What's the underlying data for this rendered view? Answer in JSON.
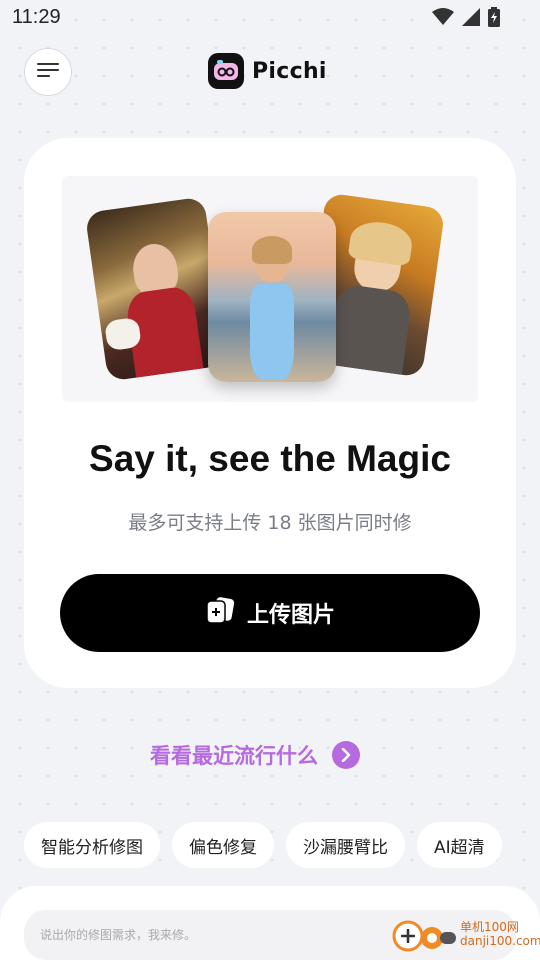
{
  "status_bar": {
    "time": "11:29",
    "icons": [
      "wifi-icon",
      "cell-signal-icon",
      "battery-icon"
    ]
  },
  "header": {
    "menu_icon": "hamburger-icon",
    "logo_text": "Picchi"
  },
  "hero": {
    "headline": "Say it, see the Magic",
    "subtitle": "最多可支持上传 18 张图片同时修",
    "upload_button_label": "上传图片",
    "upload_icon": "add-photo-icon",
    "photos": [
      "birthday-portrait-photo",
      "beach-portrait-photo",
      "autumn-portrait-photo"
    ]
  },
  "trending": {
    "label": "看看最近流行什么",
    "icon": "chevron-right-icon"
  },
  "chips": [
    {
      "label": "智能分析修图"
    },
    {
      "label": "偏色修复"
    },
    {
      "label": "沙漏腰臂比"
    },
    {
      "label": "AI超清"
    }
  ],
  "prompt": {
    "placeholder": "说出你的修图需求，我来修。"
  },
  "watermark": {
    "text_line1": "单机100网",
    "text_line2": "danji100.com"
  },
  "colors": {
    "background": "#f2f3f7",
    "accent_purple": "#b56ae0",
    "button_black": "#000000",
    "card_white": "#ffffff"
  }
}
